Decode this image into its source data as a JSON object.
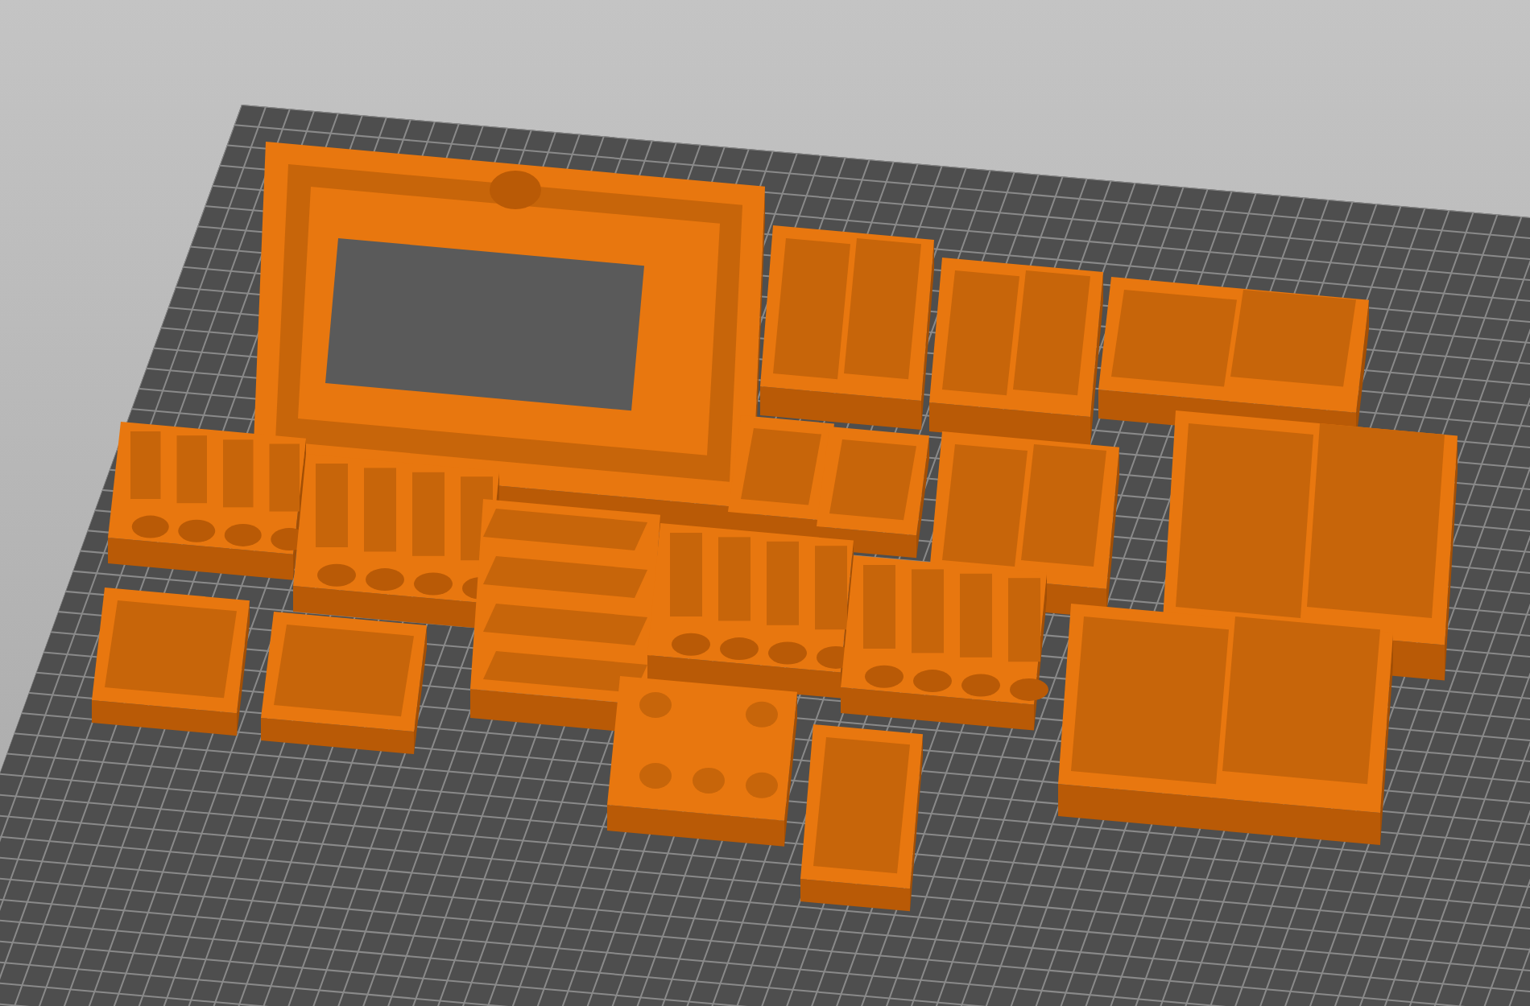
{
  "scene": {
    "parts": [
      {
        "kind": "frame"
      },
      {
        "kind": "tray"
      },
      {
        "kind": "tray"
      },
      {
        "kind": "tray"
      },
      {
        "kind": "holder"
      },
      {
        "kind": "holder"
      },
      {
        "kind": "box"
      },
      {
        "kind": "box"
      },
      {
        "kind": "tray"
      },
      {
        "kind": "tray"
      },
      {
        "kind": "rack"
      },
      {
        "kind": "holder"
      },
      {
        "kind": "holder"
      },
      {
        "kind": "box"
      },
      {
        "kind": "box"
      },
      {
        "kind": "tray"
      },
      {
        "kind": "plate"
      },
      {
        "kind": "box"
      }
    ]
  }
}
